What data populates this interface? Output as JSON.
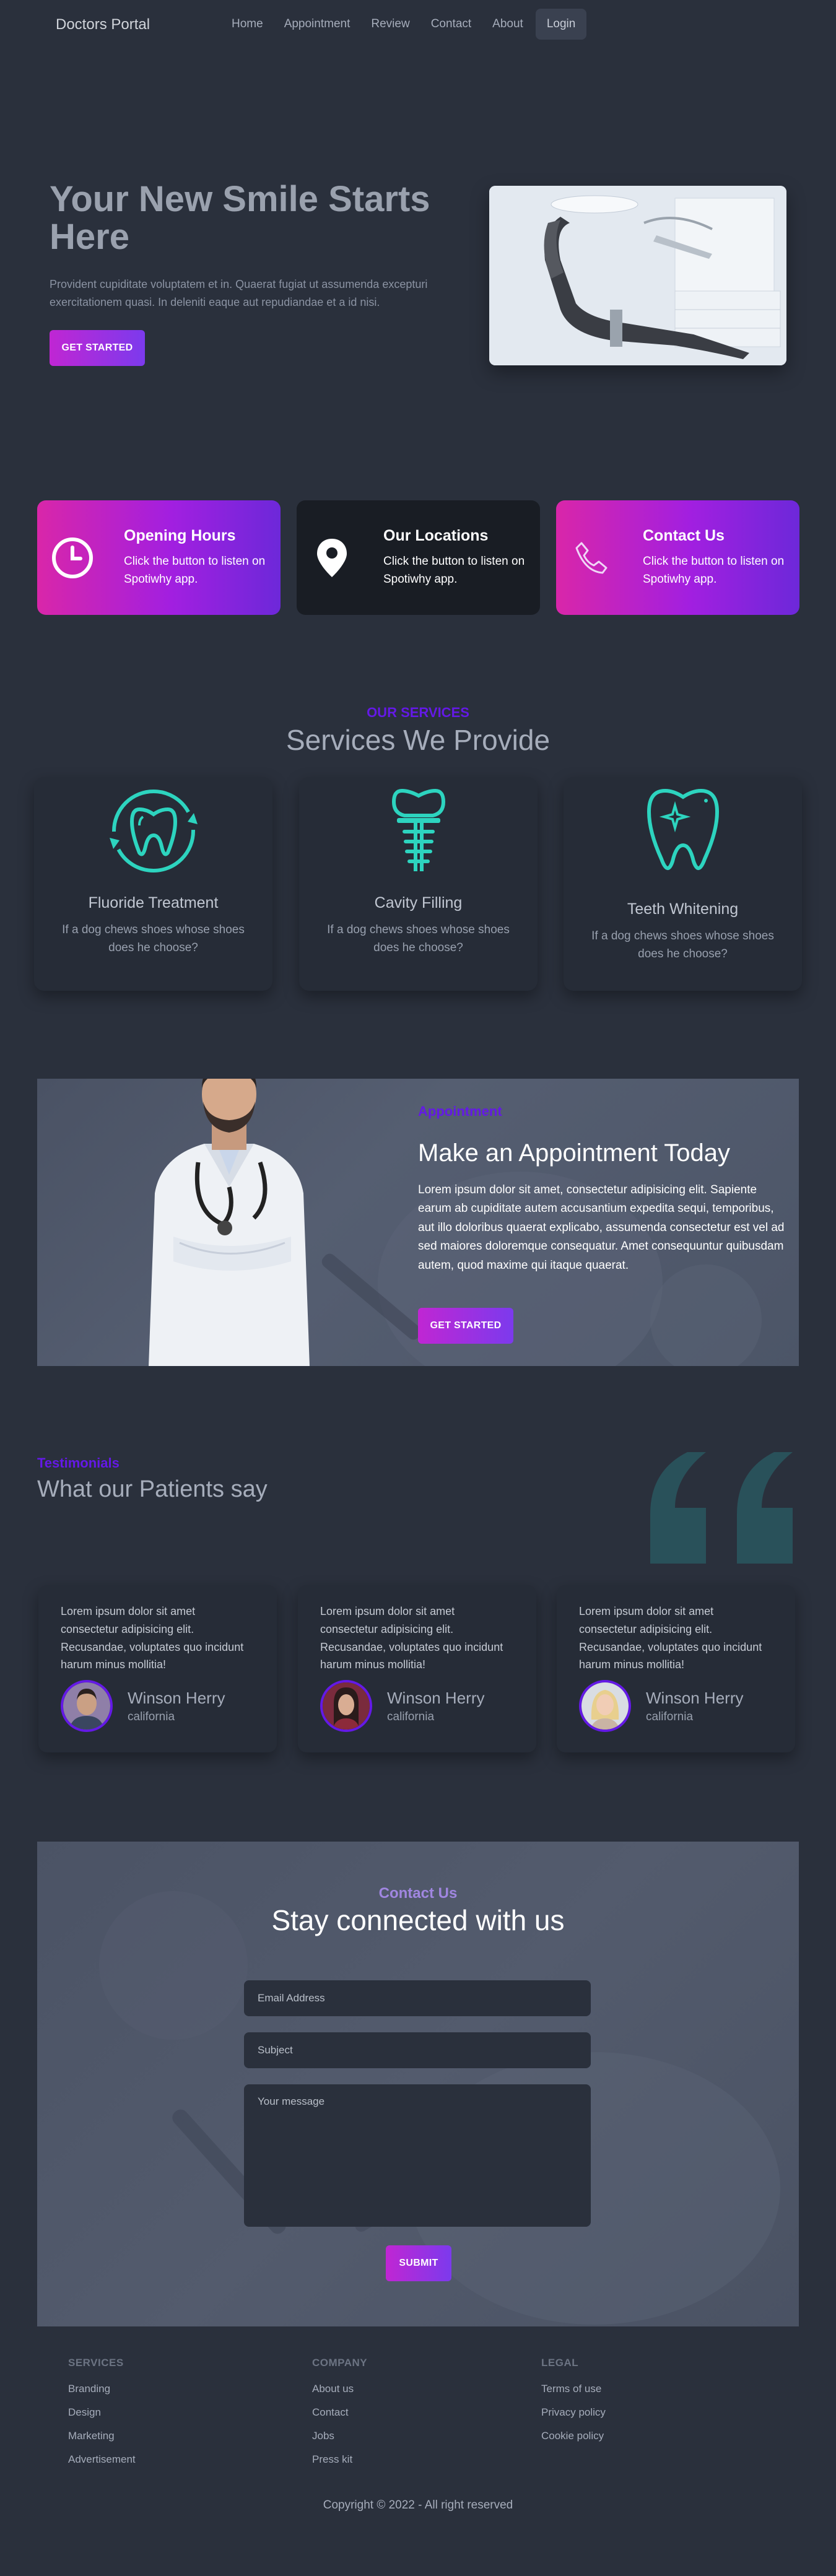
{
  "brand": "Doctors Portal",
  "nav": {
    "items": [
      "Home",
      "Appointment",
      "Review",
      "Contact",
      "About"
    ],
    "login": "Login"
  },
  "hero": {
    "title": "Your New Smile Starts Here",
    "subtitle": "Provident cupiditate voluptatem et in. Quaerat fugiat ut assumenda excepturi exercitationem quasi. In deleniti eaque aut repudiandae et a id nisi.",
    "cta": "GET STARTED"
  },
  "info_cards": [
    {
      "title": "Opening Hours",
      "text": "Click the button to listen on Spotiwhy app.",
      "icon": "clock-icon"
    },
    {
      "title": "Our Locations",
      "text": "Click the button to listen on Spotiwhy app.",
      "icon": "location-pin-icon"
    },
    {
      "title": "Contact Us",
      "text": "Click the button to listen on Spotiwhy app.",
      "icon": "phone-icon"
    }
  ],
  "services": {
    "kicker": "OUR SERVICES",
    "title": "Services We Provide",
    "items": [
      {
        "title": "Fluoride Treatment",
        "text": "If a dog chews shoes whose shoes does he choose?",
        "icon": "fluoride-tooth-icon"
      },
      {
        "title": "Cavity Filling",
        "text": "If a dog chews shoes whose shoes does he choose?",
        "icon": "dental-implant-icon"
      },
      {
        "title": "Teeth Whitening",
        "text": "If a dog chews shoes whose shoes does he choose?",
        "icon": "sparkle-tooth-icon"
      }
    ]
  },
  "appointment": {
    "kicker": "Appointment",
    "title": "Make an Appointment Today",
    "text": "Lorem ipsum dolor sit amet, consectetur adipisicing elit. Sapiente earum ab cupiditate autem accusantium expedita sequi, temporibus, aut illo doloribus quaerat explicabo, assumenda consectetur est vel ad sed maiores doloremque consequatur. Amet consequuntur quibusdam autem, quod maxime qui itaque quaerat.",
    "cta": "GET STARTED"
  },
  "testimonials": {
    "kicker": "Testimonials",
    "title": "What our Patients say",
    "items": [
      {
        "text": "Lorem ipsum dolor sit amet consectetur adipisicing elit. Recusandae, voluptates quo incidunt harum minus mollitia!",
        "name": "Winson Herry",
        "location": "california"
      },
      {
        "text": "Lorem ipsum dolor sit amet consectetur adipisicing elit. Recusandae, voluptates quo incidunt harum minus mollitia!",
        "name": "Winson Herry",
        "location": "california"
      },
      {
        "text": "Lorem ipsum dolor sit amet consectetur adipisicing elit. Recusandae, voluptates quo incidunt harum minus mollitia!",
        "name": "Winson Herry",
        "location": "california"
      }
    ]
  },
  "contact": {
    "kicker": "Contact Us",
    "title": "Stay connected with us",
    "email_placeholder": "Email Address",
    "subject_placeholder": "Subject",
    "message_placeholder": "Your message",
    "submit": "SUBMIT"
  },
  "footer": {
    "columns": [
      {
        "heading": "SERVICES",
        "links": [
          "Branding",
          "Design",
          "Marketing",
          "Advertisement"
        ]
      },
      {
        "heading": "COMPANY",
        "links": [
          "About us",
          "Contact",
          "Jobs",
          "Press kit"
        ]
      },
      {
        "heading": "LEGAL",
        "links": [
          "Terms of use",
          "Privacy policy",
          "Cookie policy"
        ]
      }
    ],
    "copyright": "Copyright © 2022 - All right reserved"
  },
  "colors": {
    "background": "#2a303c",
    "accent": "#6419e6",
    "gradient_start": "#c026d3",
    "gradient_end": "#7c3aed",
    "icon_teal": "#2dd4bf"
  }
}
